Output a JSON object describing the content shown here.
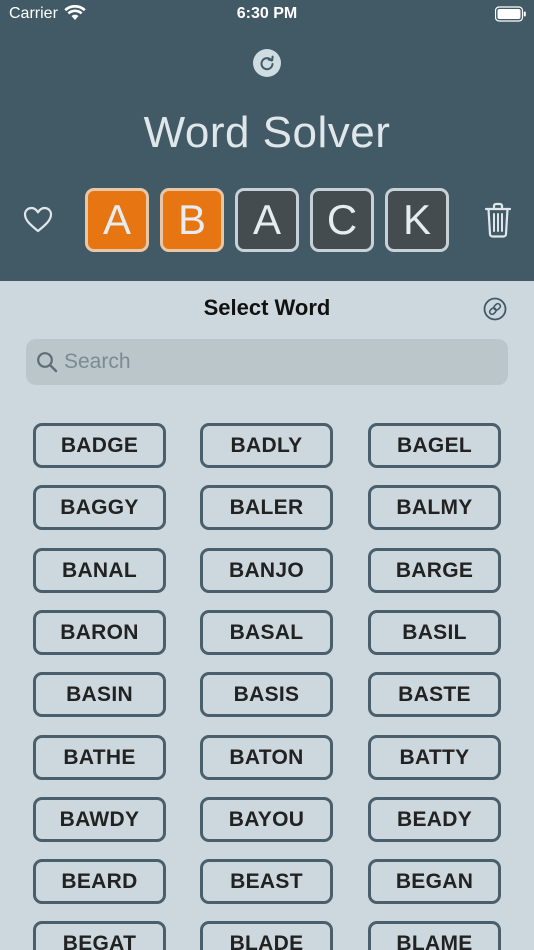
{
  "status_bar": {
    "carrier": "Carrier",
    "time": "6:30 PM"
  },
  "header": {
    "title": "Word Solver",
    "tiles": [
      {
        "letter": "A",
        "state": "orange"
      },
      {
        "letter": "B",
        "state": "orange"
      },
      {
        "letter": "A",
        "state": "gray"
      },
      {
        "letter": "C",
        "state": "gray"
      },
      {
        "letter": "K",
        "state": "gray"
      }
    ]
  },
  "colors": {
    "header_bg": "#425a66",
    "sheet_bg": "#ccd8de",
    "tile_orange": "#e67512",
    "tile_gray": "#454c4f",
    "button_border": "#4a5f6b"
  },
  "sheet": {
    "title": "Select Word",
    "search": {
      "placeholder": "Search",
      "value": ""
    },
    "words": [
      "BADGE",
      "BADLY",
      "BAGEL",
      "BAGGY",
      "BALER",
      "BALMY",
      "BANAL",
      "BANJO",
      "BARGE",
      "BARON",
      "BASAL",
      "BASIL",
      "BASIN",
      "BASIS",
      "BASTE",
      "BATHE",
      "BATON",
      "BATTY",
      "BAWDY",
      "BAYOU",
      "BEADY",
      "BEARD",
      "BEAST",
      "BEGAN",
      "BEGAT",
      "BLADE",
      "BLAME"
    ]
  },
  "icons": [
    "wifi-icon",
    "battery-icon",
    "refresh-icon",
    "heart-icon",
    "trash-icon",
    "link-icon",
    "search-icon"
  ]
}
